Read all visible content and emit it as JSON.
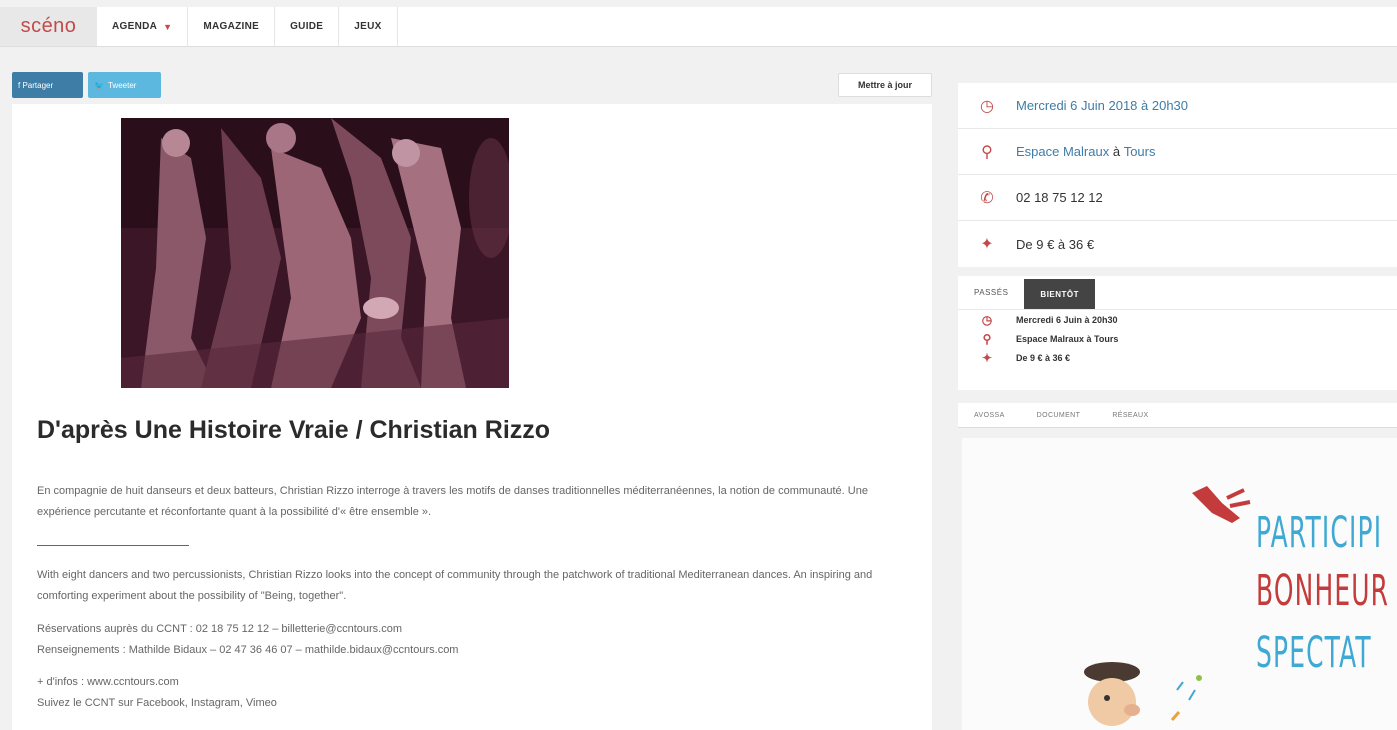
{
  "nav": {
    "logo": "scéno",
    "items": [
      "AGENDA",
      "MAGAZINE",
      "GUIDE",
      "JEUX"
    ]
  },
  "share": {
    "facebook": "f Partager",
    "twitter": "Tweeter"
  },
  "update_button": "Mettre à jour",
  "event": {
    "title": "D'après Une Histoire Vraie / Christian Rizzo",
    "desc_fr": "En compagnie de huit danseurs et deux batteurs, Christian Rizzo interroge à travers les motifs de danses traditionnelles méditerranéennes, la notion de communauté. Une expérience percutante et réconfortante quant à la possibilité d'« être ensemble ».",
    "desc_en": "With eight dancers and two percussionists, Christian Rizzo looks into the concept of community through the patchwork of traditional Mediterranean dances. An inspiring and comforting experiment about the possibility of \"Being, together\".",
    "reservations": "Réservations auprès du CCNT : 02 18 75 12 12 – billetterie@ccntours.com",
    "renseignements": "Renseignements : Mathilde Bidaux – 02 47 36 46 07 – mathilde.bidaux@ccntours.com",
    "infos": "+ d'infos : www.ccntours.com",
    "follow": "Suivez le CCNT sur Facebook, Instagram, Vimeo"
  },
  "info": {
    "date": "Mercredi 6 Juin 2018 à 20h30",
    "venue_a": "Espace Malraux",
    "venue_sep": " à ",
    "venue_b": "Tours",
    "phone": "02 18 75 12 12",
    "price": "De 9 € à 36 €"
  },
  "tabs": {
    "passes": "PASSÉS",
    "bientot": "BIENTÔT",
    "rows": [
      "Mercredi 6 Juin à 20h30",
      "Espace Malraux à Tours",
      "De 9 € à 36 €"
    ]
  },
  "tabs2": [
    "AVOSSA",
    "DOCUMENT",
    "RÉSEAUX"
  ],
  "ad": {
    "line1": "PARTICIPI",
    "line2": "BONHEUR",
    "line3": "SPECTAT"
  },
  "colors": {
    "accent": "#c44a4a",
    "link": "#3d7da6",
    "facebook": "#3d7da6",
    "twitter": "#5cb8df"
  }
}
